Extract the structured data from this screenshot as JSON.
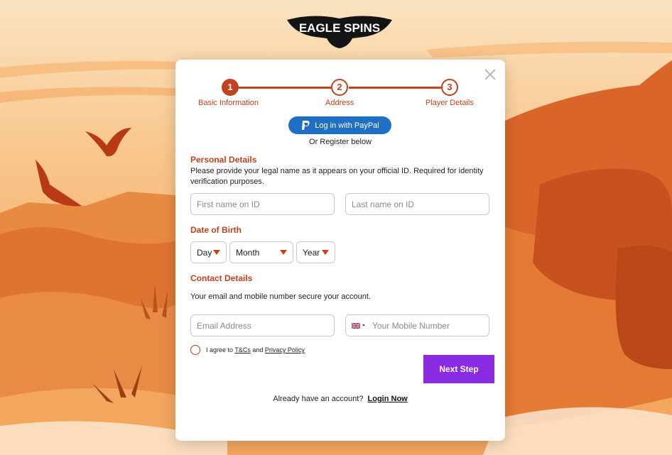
{
  "brand": {
    "logo_text": "EAGLE SPINS"
  },
  "stepper": {
    "steps": [
      {
        "number": "1",
        "label": "Basic Information",
        "state": "active"
      },
      {
        "number": "2",
        "label": "Address",
        "state": "upcoming"
      },
      {
        "number": "3",
        "label": "Player Details",
        "state": "upcoming"
      }
    ]
  },
  "paypal": {
    "button_label": "Log in with PayPal",
    "or_register": "Or Register below"
  },
  "personal": {
    "title": "Personal Details",
    "description": "Please provide your legal name as it appears on your official ID. Required for identity verification purposes.",
    "first_name_placeholder": "First name on ID",
    "last_name_placeholder": "Last name on ID"
  },
  "dob": {
    "title": "Date of Birth",
    "day": "Day",
    "month": "Month",
    "year": "Year"
  },
  "contact": {
    "title": "Contact Details",
    "description": "Your email and mobile number secure your account.",
    "email_placeholder": "Email Address",
    "mobile_placeholder": "Your Mobile Number",
    "country_flag_icon": "uk-flag-icon"
  },
  "agreement": {
    "prefix": "I agree to ",
    "terms_link": "T&Cs",
    "and": " and ",
    "privacy_link": "Privacy Policy"
  },
  "actions": {
    "next_step": "Next Step",
    "already_text": "Already have an account?",
    "login_link": "Login Now"
  },
  "colors": {
    "accent": "#c4411d",
    "next_button": "#8a2be2",
    "paypal": "#1f6fc5"
  }
}
